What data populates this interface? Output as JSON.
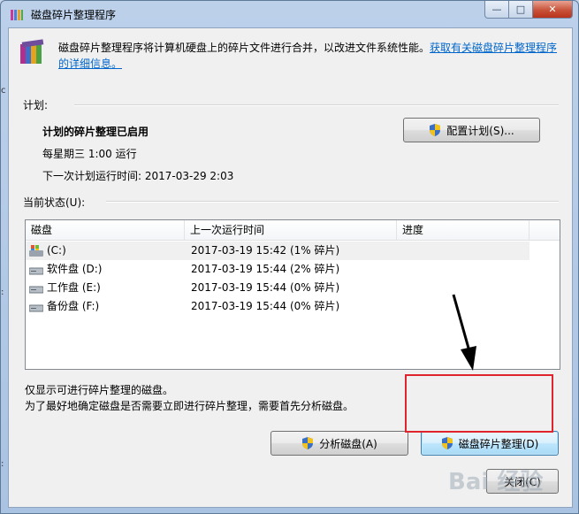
{
  "window": {
    "title": "磁盘碎片整理程序",
    "icon": "defrag-app-icon",
    "controls": {
      "minimize": "—",
      "maximize": "□",
      "close": "✕"
    }
  },
  "intro": {
    "text": "磁盘碎片整理程序将计算机硬盘上的碎片文件进行合并，以改进文件系统性能。",
    "link": "获取有关磁盘碎片整理程序的详细信息。"
  },
  "schedule": {
    "label": "计划:",
    "status": "计划的碎片整理已启用",
    "frequency": "每星期三  1:00 运行",
    "next_run": "下一次计划运行时间: 2017-03-29 2:03",
    "configure_button": "配置计划(S)..."
  },
  "current_status": {
    "label": "当前状态(U):",
    "columns": [
      "磁盘",
      "上一次运行时间",
      "进度"
    ],
    "rows": [
      {
        "disk": "(C:)",
        "last_run": "2017-03-19 15:42 (1% 碎片)",
        "progress": "",
        "icon": "system-drive-icon"
      },
      {
        "disk": "软件盘 (D:)",
        "last_run": "2017-03-19 15:44 (2% 碎片)",
        "progress": "",
        "icon": "hard-drive-icon"
      },
      {
        "disk": "工作盘 (E:)",
        "last_run": "2017-03-19 15:44 (0% 碎片)",
        "progress": "",
        "icon": "hard-drive-icon"
      },
      {
        "disk": "备份盘 (F:)",
        "last_run": "2017-03-19 15:44 (0% 碎片)",
        "progress": "",
        "icon": "hard-drive-icon"
      }
    ]
  },
  "notes": {
    "line1": "仅显示可进行碎片整理的磁盘。",
    "line2": "为了最好地确定磁盘是否需要立即进行碎片整理，需要首先分析磁盘。"
  },
  "buttons": {
    "analyze": "分析磁盘(A)",
    "defragment": "磁盘碎片整理(D)",
    "close": "关闭(C)"
  },
  "annotation": {
    "highlight_color": "#e0242b",
    "arrow_color": "#000000"
  },
  "watermark": {
    "text": "Bai 经验"
  },
  "colors": {
    "link": "#0066cc",
    "window_frame": "#aac3e2"
  }
}
